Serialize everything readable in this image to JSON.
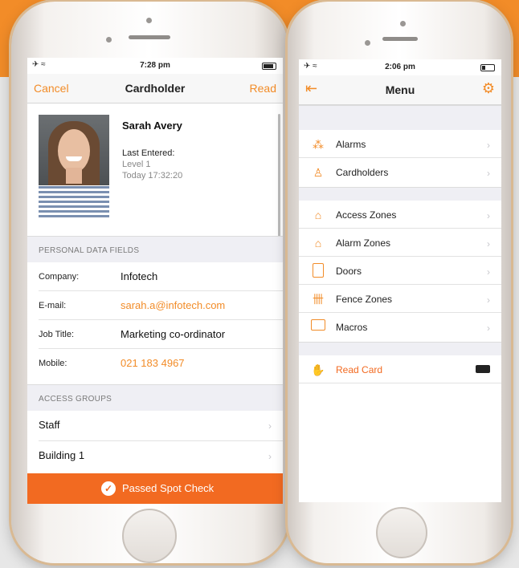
{
  "colors": {
    "accent": "#f28c28",
    "spot_bar": "#f26a21"
  },
  "left": {
    "status_time": "7:28 pm",
    "nav": {
      "left": "Cancel",
      "title": "Cardholder",
      "right": "Read"
    },
    "profile": {
      "name": "Sarah Avery",
      "last_entered_label": "Last Entered:",
      "level": "Level 1",
      "when": "Today 17:32:20"
    },
    "personal_header": "PERSONAL DATA FIELDS",
    "fields": [
      {
        "key": "Company:",
        "value": "Infotech"
      },
      {
        "key": "E-mail:",
        "value": "sarah.a@infotech.com"
      },
      {
        "key": "Job Title:",
        "value": "Marketing co-ordinator"
      },
      {
        "key": "Mobile:",
        "value": "021 183 4967"
      }
    ],
    "groups_header": "ACCESS GROUPS",
    "groups": [
      "Staff",
      "Building 1"
    ],
    "spot_check": "Passed Spot Check"
  },
  "right": {
    "status_time": "2:06 pm",
    "nav": {
      "title": "Menu"
    },
    "items": [
      {
        "label": "Alarms",
        "icon": "siren-icon"
      },
      {
        "label": "Cardholders",
        "icon": "person-card-icon"
      },
      {
        "label": "Access Zones",
        "icon": "access-zone-icon"
      },
      {
        "label": "Alarm Zones",
        "icon": "alarm-zone-icon"
      },
      {
        "label": "Doors",
        "icon": "door-icon"
      },
      {
        "label": "Fence Zones",
        "icon": "fence-icon"
      },
      {
        "label": "Macros",
        "icon": "terminal-icon"
      }
    ],
    "read_card": "Read Card"
  }
}
